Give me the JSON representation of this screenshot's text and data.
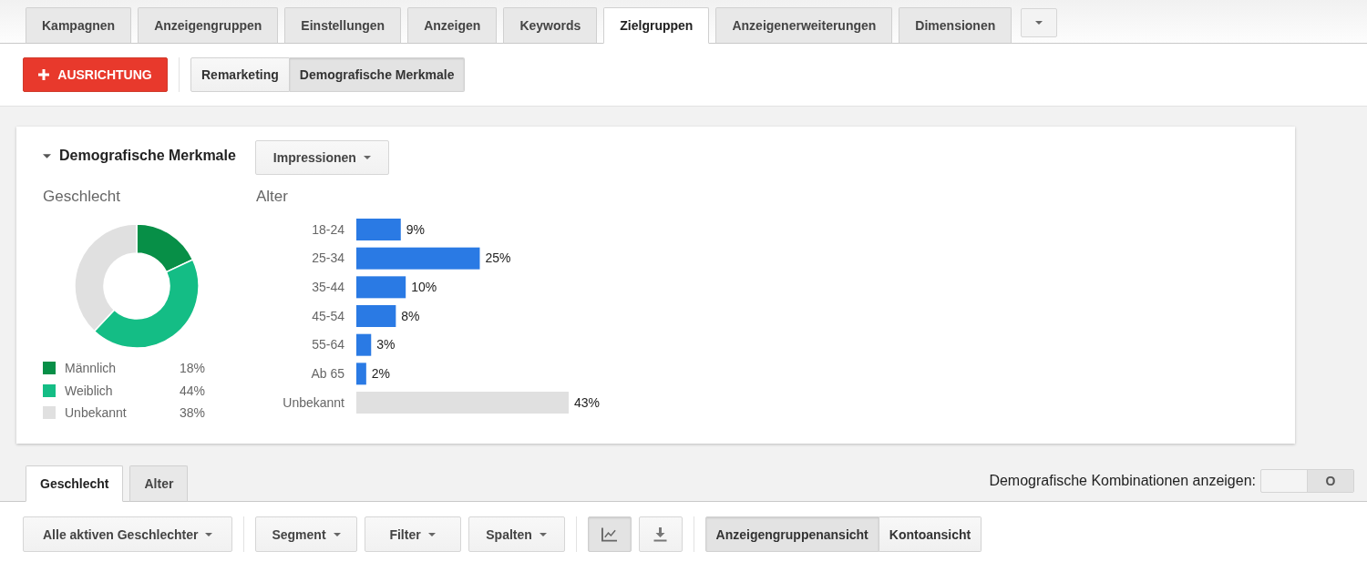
{
  "tabs": [
    {
      "label": "Kampagnen",
      "selected": false
    },
    {
      "label": "Anzeigengruppen",
      "selected": false
    },
    {
      "label": "Einstellungen",
      "selected": false
    },
    {
      "label": "Anzeigen",
      "selected": false
    },
    {
      "label": "Keywords",
      "selected": false
    },
    {
      "label": "Zielgruppen",
      "selected": true
    },
    {
      "label": "Anzeigenerweiterungen",
      "selected": false
    },
    {
      "label": "Dimensionen",
      "selected": false
    }
  ],
  "targeting": {
    "add_button": "AUSRICHTUNG",
    "views": [
      {
        "label": "Remarketing",
        "selected": false
      },
      {
        "label": "Demografische Merkmale",
        "selected": true
      }
    ]
  },
  "panel": {
    "title": "Demografische Merkmale",
    "expanded": true,
    "metric": "Impressionen",
    "gender": {
      "title": "Geschlecht",
      "chart_data": {
        "type": "donut",
        "categories": [
          "Männlich",
          "Weiblich",
          "Unbekannt"
        ],
        "values": [
          18,
          44,
          38
        ],
        "colors": [
          "#078f47",
          "#14bd85",
          "#e0e0e0"
        ],
        "value_labels": [
          "18%",
          "44%",
          "38%"
        ],
        "legend": "bottom"
      }
    },
    "age": {
      "title": "Alter",
      "chart_data": {
        "type": "bar",
        "orientation": "horizontal",
        "categories": [
          "18-24",
          "25-34",
          "35-44",
          "45-54",
          "55-64",
          "Ab 65",
          "Unbekannt"
        ],
        "values": [
          9,
          25,
          10,
          8,
          3,
          2,
          43
        ],
        "colors": [
          "#2a7ae4",
          "#2a7ae4",
          "#2a7ae4",
          "#2a7ae4",
          "#2a7ae4",
          "#2a7ae4",
          "#e0e0e0"
        ],
        "value_labels": [
          "9%",
          "25%",
          "10%",
          "8%",
          "3%",
          "2%",
          "43%"
        ]
      }
    }
  },
  "sub_tabs": [
    {
      "label": "Geschlecht",
      "selected": true
    },
    {
      "label": "Alter",
      "selected": false
    }
  ],
  "combinations_toggle": {
    "label": "Demografische Kombinationen anzeigen:",
    "state_text": "O",
    "on": false
  },
  "table_toolbar": {
    "dropdowns": [
      "Alle aktiven Geschlechter",
      "Segment",
      "Filter",
      "Spalten"
    ],
    "icon_buttons": [
      {
        "kind": "chart",
        "selected": true
      },
      {
        "kind": "download",
        "selected": false
      }
    ],
    "views": [
      {
        "label": "Anzeigengruppenansicht",
        "selected": true
      },
      {
        "label": "Kontoansicht",
        "selected": false
      }
    ]
  }
}
